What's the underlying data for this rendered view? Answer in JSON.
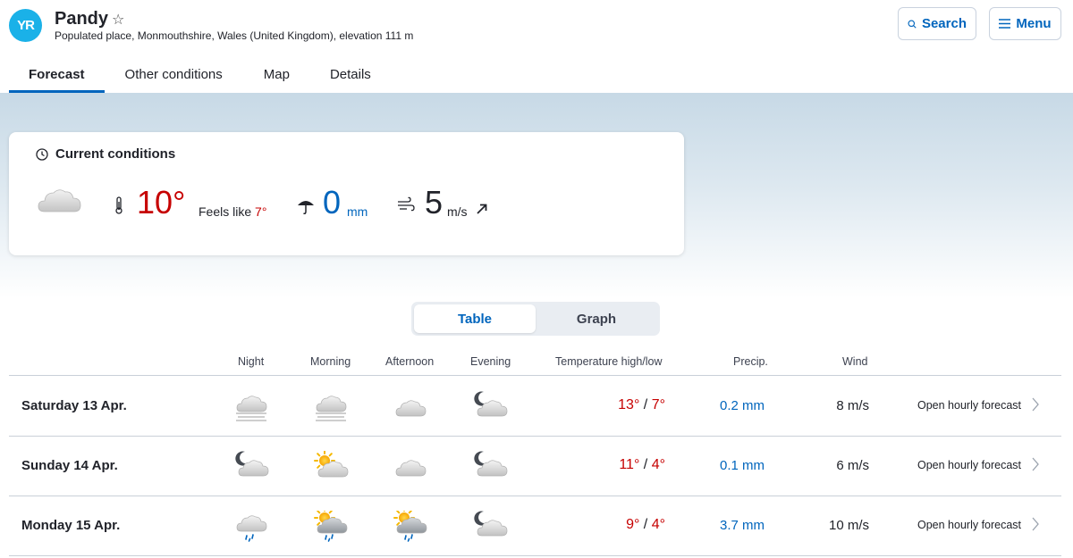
{
  "header": {
    "logo_text": "YR",
    "place_name": "Pandy",
    "place_description": "Populated place, Monmouthshire, Wales (United Kingdom), elevation 111 m",
    "search_label": "Search",
    "menu_label": "Menu"
  },
  "tabs": [
    {
      "label": "Forecast",
      "active": true
    },
    {
      "label": "Other conditions",
      "active": false
    },
    {
      "label": "Map",
      "active": false
    },
    {
      "label": "Details",
      "active": false
    }
  ],
  "current": {
    "title": "Current conditions",
    "symbol": "cloudy",
    "temperature": "10°",
    "feels_like_label": "Feels like",
    "feels_like_value": "7°",
    "precipitation_value": "0",
    "precipitation_unit": "mm",
    "wind_value": "5",
    "wind_unit": "m/s"
  },
  "view_toggle": {
    "table_label": "Table",
    "graph_label": "Graph",
    "selected": "Table"
  },
  "table": {
    "columns": {
      "night": "Night",
      "morning": "Morning",
      "afternoon": "Afternoon",
      "evening": "Evening",
      "temperature": "Temperature high/low",
      "precip": "Precip.",
      "wind": "Wind"
    },
    "rows": [
      {
        "day": "Saturday 13 Apr.",
        "symbols": [
          "fog",
          "fog",
          "cloudy",
          "partly-cloudy-night"
        ],
        "high": "13°",
        "low": "7°",
        "precip": "0.2 mm",
        "wind": "8 m/s",
        "link": "Open hourly forecast"
      },
      {
        "day": "Sunday 14 Apr.",
        "symbols": [
          "partly-cloudy-night",
          "partly-cloudy-day",
          "cloudy",
          "partly-cloudy-night"
        ],
        "high": "11°",
        "low": "4°",
        "precip": "0.1 mm",
        "wind": "6 m/s",
        "link": "Open hourly forecast"
      },
      {
        "day": "Monday 15 Apr.",
        "symbols": [
          "light-rain",
          "light-rain-showers-sun",
          "light-rain-showers-sun",
          "partly-cloudy-night"
        ],
        "high": "9°",
        "low": "4°",
        "precip": "3.7 mm",
        "wind": "10 m/s",
        "link": "Open hourly forecast"
      }
    ]
  },
  "colors": {
    "accent": "#0065bd",
    "temperature": "#c60000",
    "logo": "#1ab1e8"
  }
}
